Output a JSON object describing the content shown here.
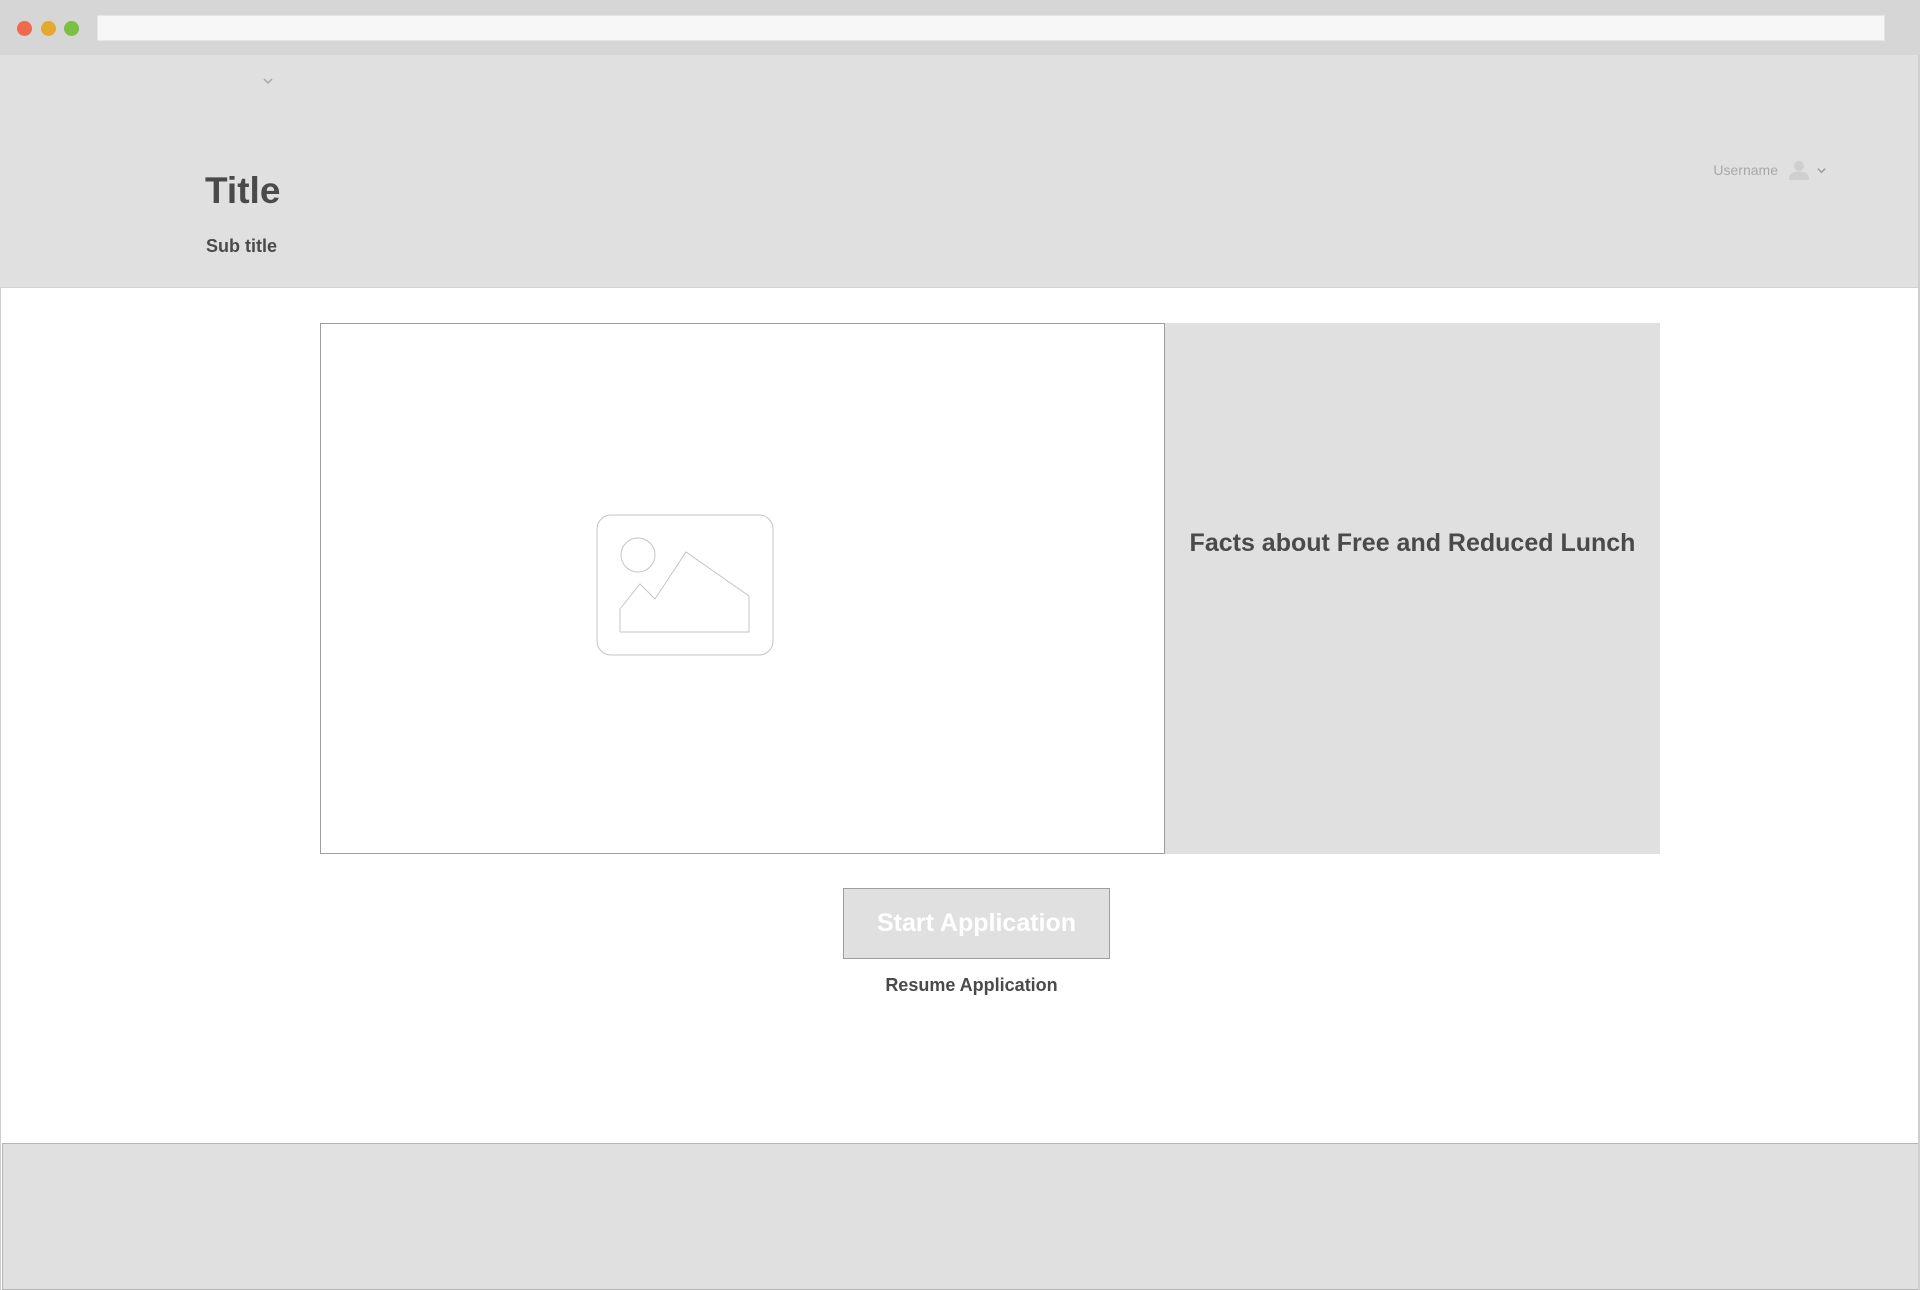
{
  "header": {
    "title": "Title",
    "subtitle": "Sub title",
    "nav_icon": "chevron-down-icon",
    "user": {
      "username": "Username",
      "avatar_icon": "user-avatar-icon",
      "menu_icon": "chevron-down-icon"
    }
  },
  "main": {
    "media": {
      "icon": "image-placeholder-icon"
    },
    "facts": {
      "title": "Facts about Free and Reduced Lunch"
    },
    "start_button_label": "Start Application",
    "resume_link_label": "Resume Application"
  },
  "colors": {
    "panel_gray": "#e0e0e0",
    "text_dark": "#4a4a4a",
    "text_muted": "#a8a8a8",
    "chrome_gray": "#d6d6d6",
    "window_red": "#ed6a4f",
    "window_yellow": "#e5a82e",
    "window_green": "#7ac043"
  }
}
